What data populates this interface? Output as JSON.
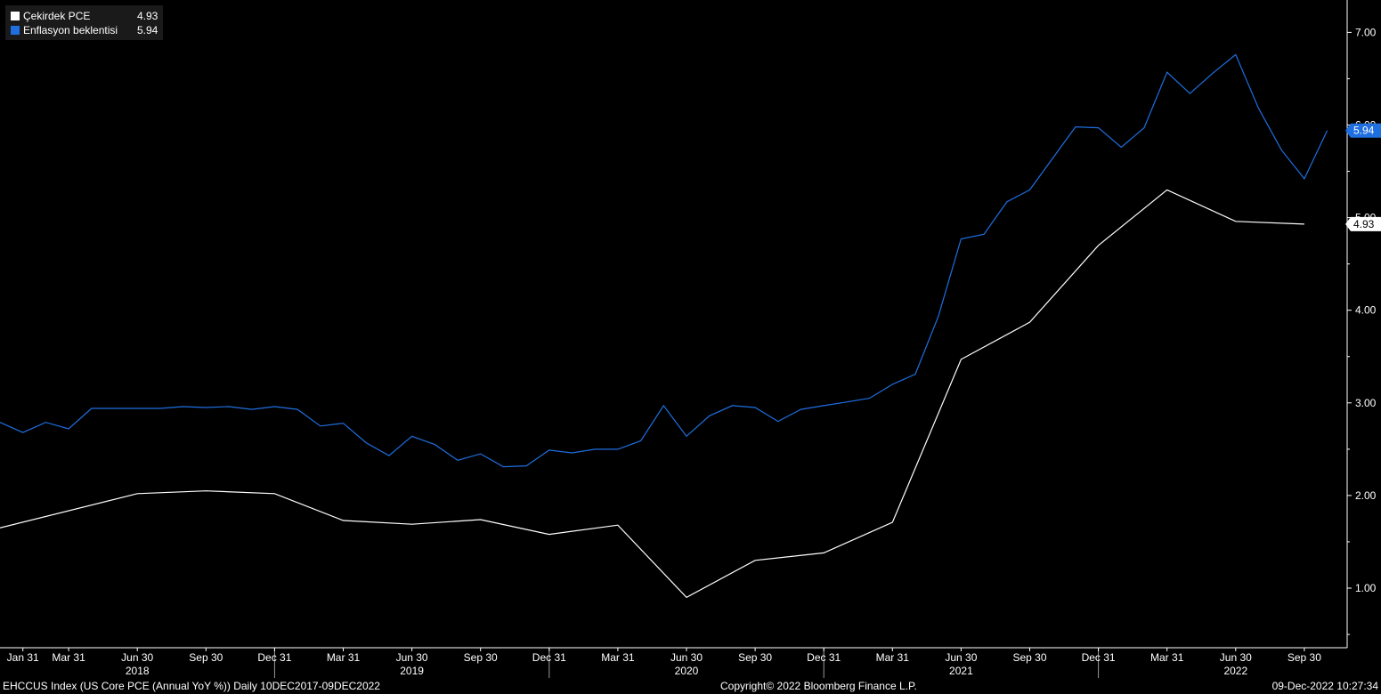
{
  "legend": [
    {
      "name": "Çekirdek PCE",
      "last": "4.93",
      "color": "#ffffff"
    },
    {
      "name": "Enflasyon beklentisi",
      "last": "5.94",
      "color": "#1f6fe0"
    }
  ],
  "footer": {
    "left": "EHCCUS Index (US Core PCE (Annual YoY %))  Daily 10DEC2017-09DEC2022",
    "center": "Copyright© 2022 Bloomberg Finance L.P.",
    "right": "09-Dec-2022 10:27:34"
  },
  "chart_data": {
    "type": "line",
    "ylim": [
      0.4,
      7.3
    ],
    "yticks": [
      "1.00",
      "2.00",
      "3.00",
      "4.00",
      "5.00",
      "6.00",
      "7.00"
    ],
    "x_tick_labels": [
      "Jan 31",
      "Mar 31",
      "Jun 30",
      "Sep 30",
      "Dec 31",
      "Mar 31",
      "Jun 30",
      "Sep 30",
      "Dec 31",
      "Mar 31",
      "Jun 30",
      "Sep 30",
      "Dec 31",
      "Mar 31",
      "Jun 30",
      "Sep 30",
      "Dec 31",
      "Mar 31",
      "Jun 30",
      "Sep 30"
    ],
    "x_tick_months": [
      1,
      3,
      6,
      9,
      12,
      15,
      18,
      21,
      24,
      27,
      30,
      33,
      36,
      39,
      42,
      45,
      48,
      51,
      54,
      57
    ],
    "year_labels": [
      "2018",
      "2019",
      "2020",
      "2021",
      "2022"
    ],
    "year_label_months": [
      6,
      18,
      30,
      42,
      54
    ],
    "year_dividers_months": [
      12,
      24,
      36,
      48
    ],
    "series": [
      {
        "name": "Çekirdek PCE",
        "color": "#ffffff",
        "x_months": [
          0,
          6,
          9,
          12,
          15,
          18,
          21,
          24,
          27,
          30,
          33,
          36,
          39,
          42,
          45,
          48,
          51,
          54,
          57
        ],
        "values": [
          1.65,
          2.02,
          2.05,
          2.02,
          1.73,
          1.69,
          1.74,
          1.58,
          1.68,
          0.9,
          1.3,
          1.38,
          1.71,
          3.47,
          3.87,
          4.7,
          5.3,
          4.96,
          4.93
        ],
        "last": 4.93
      },
      {
        "name": "Enflasyon beklentisi",
        "color": "#1f6fe0",
        "x_months": [
          0,
          1,
          2,
          3,
          4,
          5,
          6,
          7,
          8,
          9,
          10,
          11,
          12,
          13,
          14,
          15,
          16,
          17,
          18,
          19,
          20,
          21,
          22,
          23,
          24,
          25,
          26,
          27,
          28,
          29,
          30,
          31,
          32,
          33,
          34,
          35,
          36,
          37,
          38,
          39,
          40,
          41,
          42,
          43,
          44,
          45,
          46,
          47,
          48,
          49,
          50,
          51,
          52,
          53,
          54,
          55,
          56,
          57,
          58
        ],
        "values": [
          2.79,
          2.68,
          2.79,
          2.72,
          2.94,
          2.94,
          2.94,
          2.94,
          2.96,
          2.95,
          2.96,
          2.93,
          2.96,
          2.93,
          2.75,
          2.78,
          2.57,
          2.43,
          2.64,
          2.55,
          2.38,
          2.45,
          2.31,
          2.32,
          2.49,
          2.46,
          2.5,
          2.5,
          2.59,
          2.97,
          2.64,
          2.86,
          2.97,
          2.95,
          2.8,
          2.93,
          2.97,
          3.01,
          3.05,
          3.2,
          3.31,
          3.93,
          4.77,
          4.82,
          5.17,
          5.3,
          5.64,
          5.98,
          5.97,
          5.76,
          5.97,
          6.57,
          6.34,
          6.56,
          6.76,
          6.18,
          5.73,
          5.42,
          5.94
        ],
        "last": 5.94
      }
    ]
  }
}
